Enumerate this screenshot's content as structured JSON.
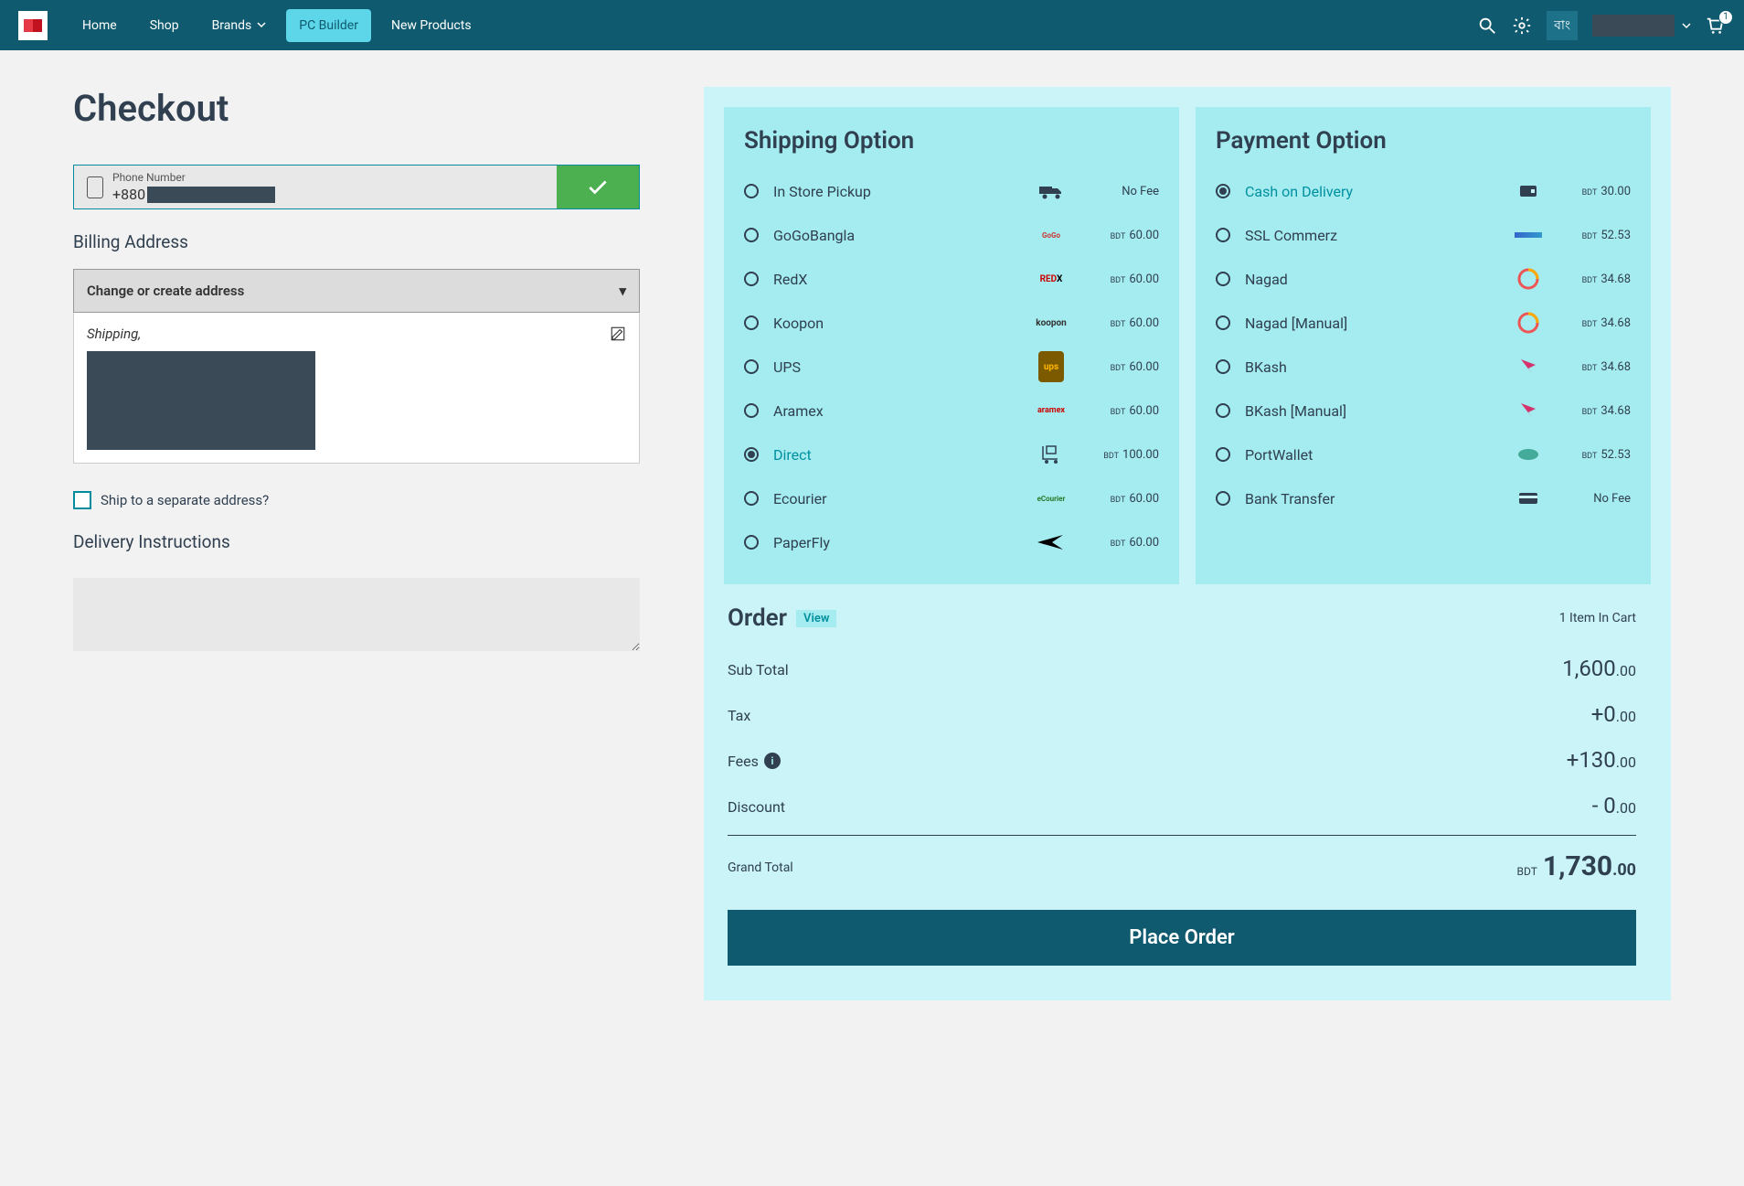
{
  "nav": {
    "home": "Home",
    "shop": "Shop",
    "brands": "Brands",
    "pc_builder": "PC Builder",
    "new_products": "New Products"
  },
  "header": {
    "lang": "বাং",
    "cart_count": "1"
  },
  "page": {
    "title": "Checkout"
  },
  "phone": {
    "label": "Phone Number",
    "prefix": "+880"
  },
  "billing": {
    "heading": "Billing Address",
    "change": "Change or create address",
    "type": "Shipping,"
  },
  "ship_separate": "Ship to a separate address?",
  "delivery_heading": "Delivery Instructions",
  "shipping": {
    "title": "Shipping Option",
    "items": [
      {
        "label": "In Store Pickup",
        "fee": "No Fee",
        "logo": "truck",
        "selected": false
      },
      {
        "label": "GoGoBangla",
        "fee": "60.00",
        "cur": "BDT",
        "logo": "gogo",
        "selected": false
      },
      {
        "label": "RedX",
        "fee": "60.00",
        "cur": "BDT",
        "logo": "redx",
        "selected": false
      },
      {
        "label": "Koopon",
        "fee": "60.00",
        "cur": "BDT",
        "logo": "koopon",
        "selected": false
      },
      {
        "label": "UPS",
        "fee": "60.00",
        "cur": "BDT",
        "logo": "ups",
        "selected": false
      },
      {
        "label": "Aramex",
        "fee": "60.00",
        "cur": "BDT",
        "logo": "aramex",
        "selected": false
      },
      {
        "label": "Direct",
        "fee": "100.00",
        "cur": "BDT",
        "logo": "trolley",
        "selected": true
      },
      {
        "label": "Ecourier",
        "fee": "60.00",
        "cur": "BDT",
        "logo": "ecourier",
        "selected": false
      },
      {
        "label": "PaperFly",
        "fee": "60.00",
        "cur": "BDT",
        "logo": "paperfly",
        "selected": false
      }
    ]
  },
  "payment": {
    "title": "Payment Option",
    "items": [
      {
        "label": "Cash on Delivery",
        "fee": "30.00",
        "cur": "BDT",
        "logo": "wallet",
        "selected": true
      },
      {
        "label": "SSL Commerz",
        "fee": "52.53",
        "cur": "BDT",
        "logo": "ssl",
        "selected": false
      },
      {
        "label": "Nagad",
        "fee": "34.68",
        "cur": "BDT",
        "logo": "nagad",
        "selected": false
      },
      {
        "label": "Nagad [Manual]",
        "fee": "34.68",
        "cur": "BDT",
        "logo": "nagad",
        "selected": false
      },
      {
        "label": "BKash",
        "fee": "34.68",
        "cur": "BDT",
        "logo": "bkash",
        "selected": false
      },
      {
        "label": "BKash [Manual]",
        "fee": "34.68",
        "cur": "BDT",
        "logo": "bkash",
        "selected": false
      },
      {
        "label": "PortWallet",
        "fee": "52.53",
        "cur": "BDT",
        "logo": "portwallet",
        "selected": false
      },
      {
        "label": "Bank Transfer",
        "fee": "No Fee",
        "logo": "card",
        "selected": false
      }
    ]
  },
  "order": {
    "title": "Order",
    "view": "View",
    "cart_summary": "1 Item In Cart",
    "subtotal_lbl": "Sub Total",
    "subtotal_main": "1,600",
    "subtotal_dec": ".00",
    "tax_lbl": "Tax",
    "tax_main": "+0",
    "tax_dec": ".00",
    "fees_lbl": "Fees",
    "fees_main": "+130",
    "fees_dec": ".00",
    "discount_lbl": "Discount",
    "discount_main": "- 0",
    "discount_dec": ".00",
    "grand_lbl": "Grand Total",
    "grand_cur": "BDT",
    "grand_main": "1,730",
    "grand_dec": ".00",
    "place": "Place Order"
  }
}
